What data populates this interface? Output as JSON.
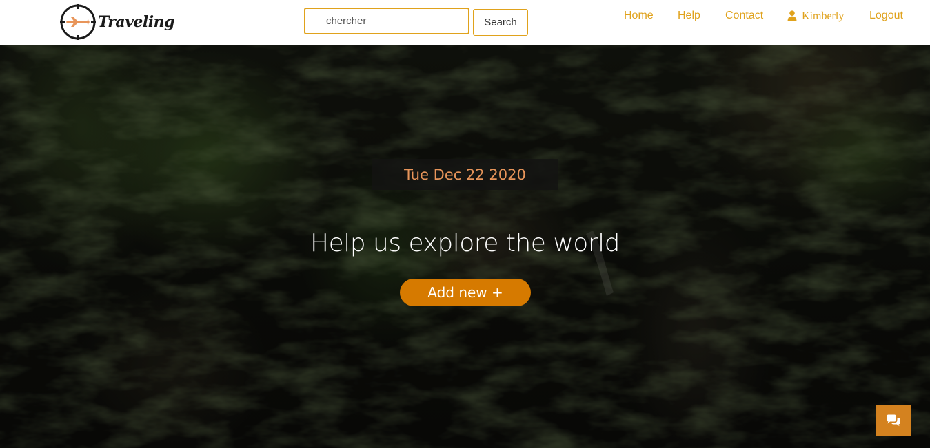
{
  "brand": {
    "name": "Traveling",
    "logo_icon": "plane-compass-icon"
  },
  "search": {
    "placeholder": "chercher",
    "button_label": "Search"
  },
  "nav": {
    "home": "Home",
    "help": "Help",
    "contact": "Contact",
    "user_name": "Kimberly",
    "user_icon": "user-icon",
    "logout": "Logout"
  },
  "hero": {
    "date": "Tue Dec 22 2020",
    "tagline": "Help us explore the world",
    "add_button": "Add new +"
  },
  "chat": {
    "icon": "chat-bubbles-icon"
  },
  "colors": {
    "accent": "#e0a21c",
    "button": "#d67a00",
    "chat": "#d4821f",
    "date_text": "#e8955a"
  }
}
